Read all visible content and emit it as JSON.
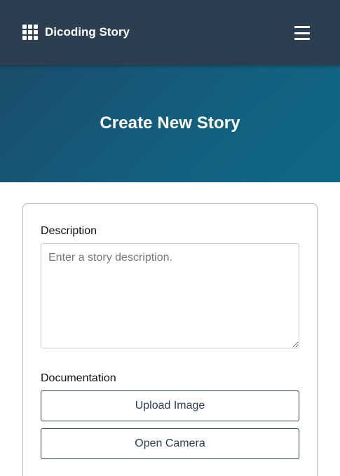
{
  "header": {
    "brand_name": "Dicoding Story",
    "brand_icon": "grid-icon",
    "menu_icon": "hamburger-menu-icon"
  },
  "hero": {
    "title": "Create New Story"
  },
  "form": {
    "description_label": "Description",
    "description_placeholder": "Enter a story description.",
    "description_value": "",
    "documentation_label": "Documentation",
    "upload_button_label": "Upload Image",
    "camera_button_label": "Open Camera"
  },
  "colors": {
    "navbar": "#2c3e50",
    "hero_gradient_start": "#1b4c6b",
    "hero_gradient_end": "#0f6886",
    "button_border": "#2c3e50",
    "card_border": "#b8b8b8"
  }
}
